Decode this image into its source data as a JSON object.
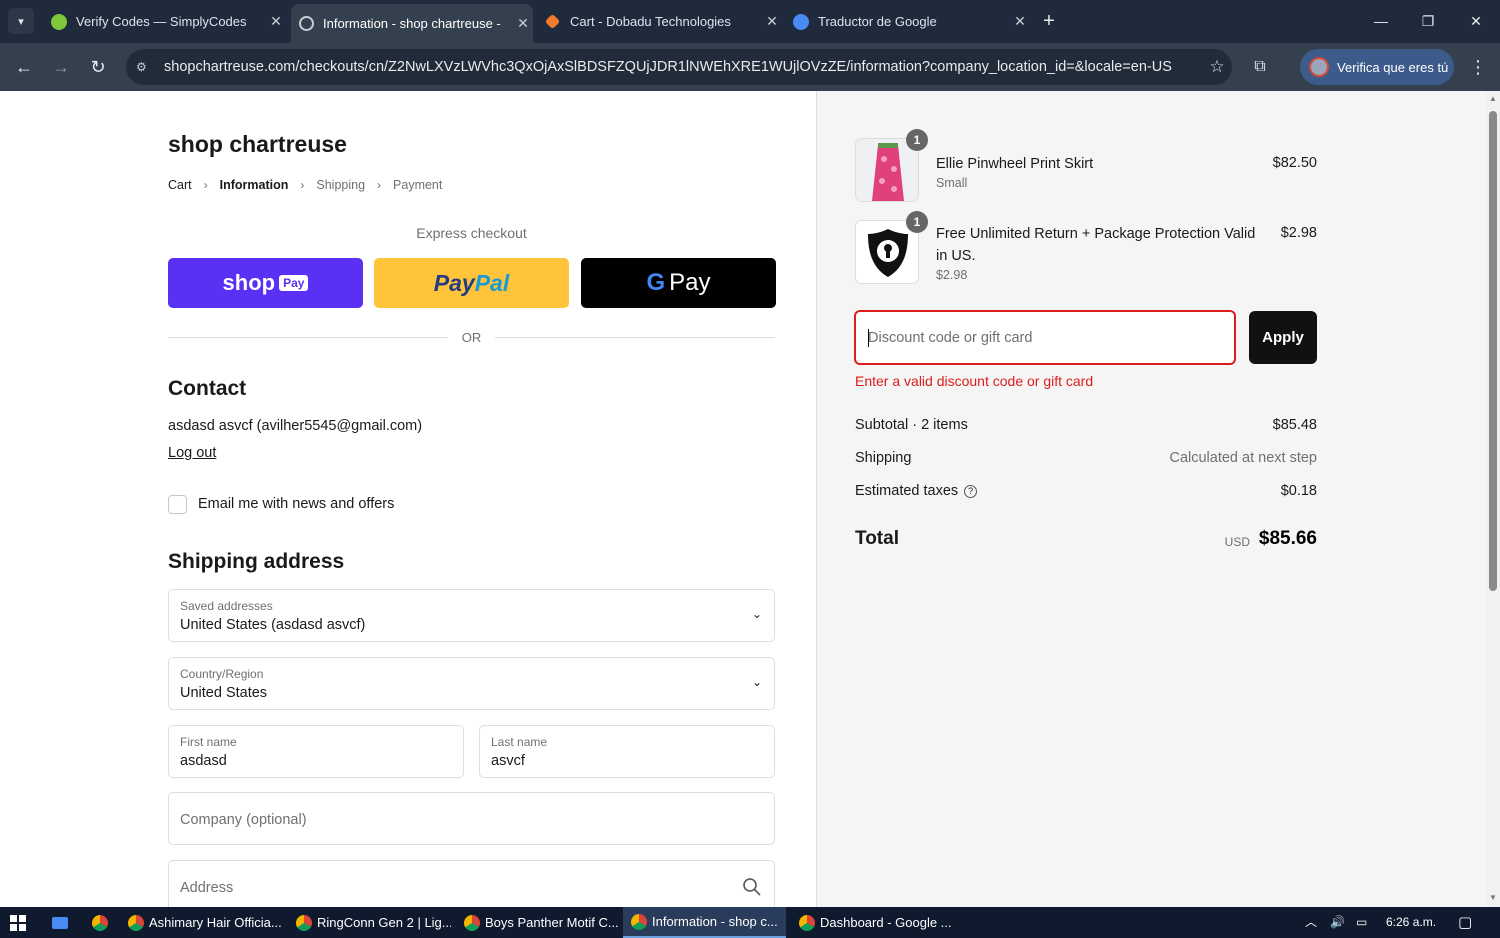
{
  "browser": {
    "tabs": [
      {
        "label": "Verify Codes — SimplyCodes",
        "close": "✕"
      },
      {
        "label": "Information - shop chartreuse -",
        "close": "✕"
      },
      {
        "label": "Cart - Dobadu Technologies",
        "close": "✕"
      },
      {
        "label": "Traductor de Google",
        "close": "✕"
      }
    ],
    "new_tab": "+",
    "url": "shopchartreuse.com/checkouts/cn/Z2NwLXVzLWVhc3QxOjAxSlBDSFZQUjJDR1lNWEhXRE1WUjlOVzZE/information?company_location_id=&locale=en-US",
    "profile_label": "Verifica que eres tú",
    "colors": {
      "chrome_bg": "#1f2a3c",
      "toolbar_bg": "#35404f"
    }
  },
  "checkout": {
    "shop_name": "shop chartreuse",
    "breadcrumb": [
      "Cart",
      "Information",
      "Shipping",
      "Payment"
    ],
    "express_checkout": "Express checkout",
    "shop_pay": {
      "brand": "shop",
      "pay": "Pay"
    },
    "paypal": {
      "p1": "Pay",
      "p2": "Pal"
    },
    "gpay": {
      "g": "G",
      "pay": "Pay"
    },
    "or": "OR",
    "contact": {
      "title": "Contact",
      "account": "asdasd asvcf (avilher5545@gmail.com)",
      "logout": "Log out",
      "newsletter": "Email me with news and offers"
    },
    "shipping": {
      "title": "Shipping address",
      "saved_label": "Saved addresses",
      "saved_value": "United States (asdasd asvcf)",
      "country_label": "Country/Region",
      "country_value": "United States",
      "first_label": "First name",
      "first_value": "asdasd",
      "last_label": "Last name",
      "last_value": "asvcf",
      "company_placeholder": "Company (optional)",
      "address_placeholder": "Address"
    }
  },
  "summary": {
    "items": [
      {
        "qty": "1",
        "name": "Ellie Pinwheel Print Skirt",
        "variant": "Small",
        "price": "$82.50"
      },
      {
        "qty": "1",
        "name": "Free Unlimited Return + Package Protection Valid in US.",
        "variant": "$2.98",
        "price": "$2.98"
      }
    ],
    "discount_placeholder": "Discount code or gift card",
    "apply": "Apply",
    "error": "Enter a valid discount code or gift card",
    "subtotal_label": "Subtotal · 2 items",
    "subtotal_value": "$85.48",
    "shipping_label": "Shipping",
    "shipping_value": "Calculated at next step",
    "taxes_label": "Estimated taxes",
    "taxes_value": "$0.18",
    "total_label": "Total",
    "currency": "USD",
    "total_value": "$85.66",
    "colors": {
      "error": "#dd1d1d",
      "shop_pay": "#5a31f4",
      "paypal": "#ffc439"
    }
  },
  "taskbar": {
    "apps": [
      "Ashimary Hair Officia...",
      "RingConn Gen 2 | Lig...",
      "Boys Panther Motif C...",
      "Information - shop c...",
      "Dashboard - Google ..."
    ],
    "time": "6:26 a.m."
  }
}
